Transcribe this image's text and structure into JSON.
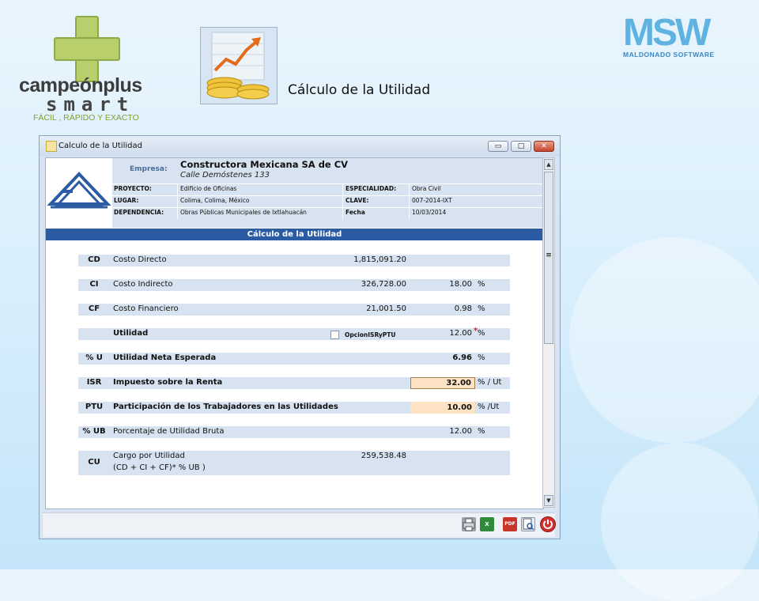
{
  "slide": {
    "brand_main": "campeónplus",
    "brand_sub": "smart",
    "slogan": "FÁCIL , RÁPIDO Y EXACTO",
    "title": "Cálculo de la Utilidad",
    "right_logo": "MSW",
    "right_logo_sub": "MALDONADO SOFTWARE"
  },
  "window": {
    "title": "Calculo de la Utilidad",
    "buttons": {
      "minimize": "▭",
      "maximize": "□",
      "close": "✕"
    }
  },
  "header": {
    "empresa_label": "Empresa:",
    "empresa_name": "Constructora Mexicana SA de CV",
    "empresa_address": "Calle Demóstenes 133",
    "rows": [
      {
        "l1": "PROYECTO:",
        "v1": "Edificio de Oficinas",
        "l2": "ESPECIALIDAD:",
        "v2": "Obra Civil"
      },
      {
        "l1": "LUGAR:",
        "v1": "Colima, Colima, México",
        "l2": "CLAVE:",
        "v2": "007-2014-IXT"
      },
      {
        "l1": "DEPENDENCIA:",
        "v1": "Obras Públicas Municipales de Ixtlahuacán",
        "l2": "Fecha",
        "v2": "10/03/2014"
      }
    ],
    "banner": "Cálculo de la Utilidad"
  },
  "rows": {
    "cd": {
      "code": "CD",
      "desc": "Costo Directo",
      "amount": "1,815,091.20"
    },
    "ci": {
      "code": "CI",
      "desc": "Costo Indirecto",
      "amount": "326,728.00",
      "pct": "18.00",
      "unit": "%"
    },
    "cf": {
      "code": "CF",
      "desc": "Costo Financiero",
      "amount": "21,001.50",
      "pct": "0.98",
      "unit": "%"
    },
    "ut": {
      "desc": "Utilidad",
      "option": "OpcionISRyPTU",
      "pct": "12.00",
      "unit": "%",
      "mark": "*"
    },
    "pu": {
      "code": "% U",
      "desc": "Utilidad Neta Esperada",
      "pct": "6.96",
      "unit": "%"
    },
    "isr": {
      "code": "ISR",
      "desc": "Impuesto sobre la Renta",
      "pct": "32.00",
      "unit": "% / Ut"
    },
    "ptu": {
      "code": "PTU",
      "desc": "Participación de los Trabajadores en las Utilidades",
      "pct": "10.00",
      "unit": "% /Ut"
    },
    "ub": {
      "code": "% UB",
      "desc": "Porcentaje de Utilidad Bruta",
      "pct": "12.00",
      "unit": "%"
    },
    "cu": {
      "code": "CU",
      "desc": "Cargo por Utilidad",
      "formula": "(CD + CI + CF)* % UB )",
      "amount": "259,538.48"
    }
  },
  "toolbar": {
    "print_icon": "printer-icon",
    "excel_icon": "excel-icon",
    "excel_text": "X",
    "pdf_icon": "pdf-icon",
    "pdf_text": "PDF",
    "preview_icon": "preview-icon",
    "exit_icon": "power-icon"
  },
  "colors": {
    "accent": "#2b5ca3",
    "row_bg": "#d7e3f0",
    "highlight": "#fde3c4"
  }
}
